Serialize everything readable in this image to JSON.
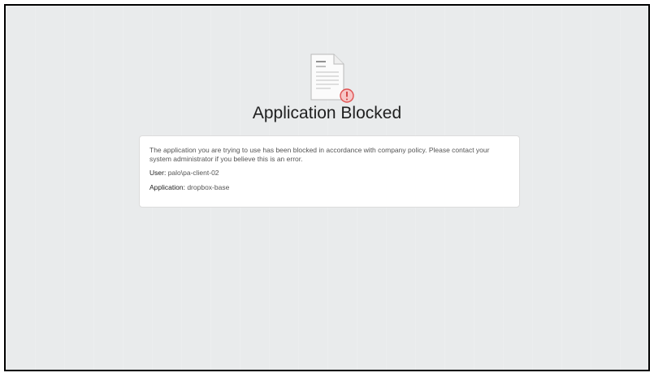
{
  "page": {
    "icon": "blocked-document-icon",
    "title": "Application Blocked"
  },
  "card": {
    "message": "The application you are trying to use has been blocked in accordance with company policy. Please contact your system administrator if you believe this is an error.",
    "user_label": "User:",
    "user_value": "palo\\pa-client-02",
    "application_label": "Application:",
    "application_value": "dropbox-base"
  },
  "colors": {
    "background": "#e9ebec",
    "card": "#ffffff",
    "warning": "#e05252"
  }
}
